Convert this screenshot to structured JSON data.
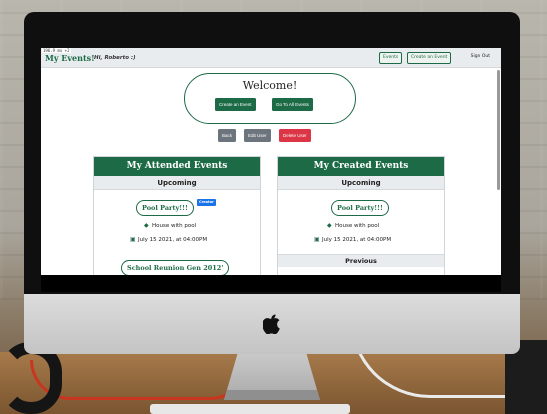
{
  "debug_badge": "196.9 mx +2",
  "navbar": {
    "brand": "My Events!",
    "greeting": "Hi, Roberto :)",
    "events_label": "Events",
    "create_event_label": "Create an Event",
    "sign_out_label": "Sign Out"
  },
  "welcome": {
    "title": "Welcome!",
    "create_event_label": "Create an Event",
    "go_all_events_label": "Go To All Events"
  },
  "actions": {
    "back_label": "Back",
    "edit_user_label": "Edit User",
    "delete_user_label": "Delete User"
  },
  "attended": {
    "title": "My Attended Events",
    "upcoming_label": "Upcoming",
    "events": [
      {
        "name": "Pool Party!!!",
        "badge": "Creator",
        "location": "House with pool",
        "datetime": "July 15 2021, at 04:00PM"
      },
      {
        "name": "School Reunion Gen 2012'"
      }
    ]
  },
  "created": {
    "title": "My Created Events",
    "upcoming_label": "Upcoming",
    "previous_label": "Previous",
    "events": [
      {
        "name": "Pool Party!!!",
        "location": "House with pool",
        "datetime": "July 15 2021, at 04:00PM"
      }
    ]
  },
  "colors": {
    "brand_green": "#1d6b46",
    "back_gray": "#6c757d",
    "delete_red": "#dc3545",
    "badge_blue": "#1a73e8"
  }
}
